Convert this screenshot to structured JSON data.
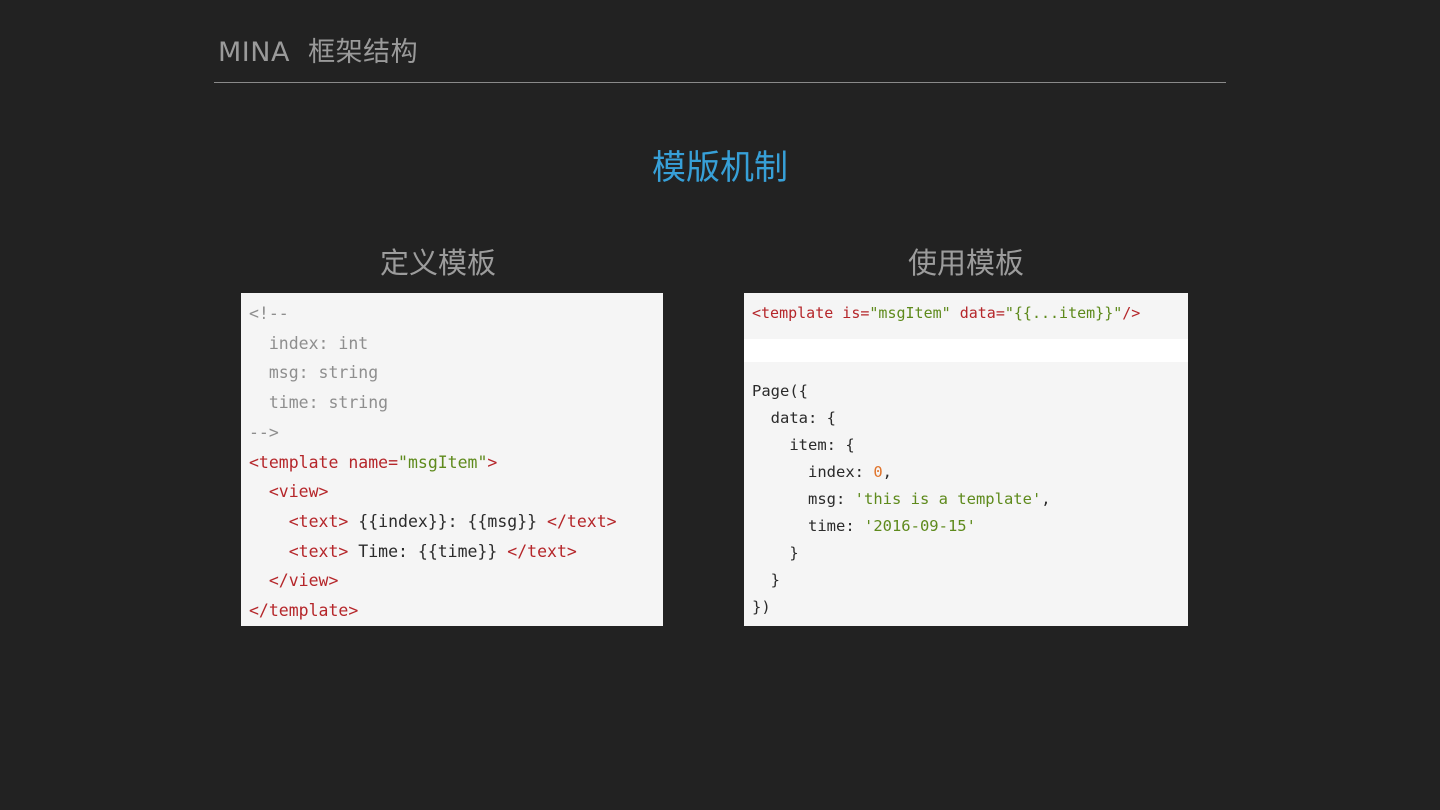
{
  "header": {
    "title": "MINA  框架结构"
  },
  "main_title": "模版机制",
  "left": {
    "heading": "定义模板",
    "code_lines": [
      [
        {
          "t": "<!--",
          "c": "c-comment"
        }
      ],
      [
        {
          "t": "  index: int",
          "c": "c-comment"
        }
      ],
      [
        {
          "t": "  msg: string",
          "c": "c-comment"
        }
      ],
      [
        {
          "t": "  time: string",
          "c": "c-comment"
        }
      ],
      [
        {
          "t": "-->",
          "c": "c-comment"
        }
      ],
      [
        {
          "t": "<template name=",
          "c": "c-tag"
        },
        {
          "t": "\"msgItem\"",
          "c": "c-attr-val"
        },
        {
          "t": ">",
          "c": "c-tag"
        }
      ],
      [
        {
          "t": "  <view>",
          "c": "c-tag"
        }
      ],
      [
        {
          "t": "    <text>",
          "c": "c-tag"
        },
        {
          "t": " {{index}}: {{msg}} ",
          "c": "c-plain"
        },
        {
          "t": "</text>",
          "c": "c-tag"
        }
      ],
      [
        {
          "t": "    <text>",
          "c": "c-tag"
        },
        {
          "t": " Time: {{time}} ",
          "c": "c-plain"
        },
        {
          "t": "</text>",
          "c": "c-tag"
        }
      ],
      [
        {
          "t": "  </view>",
          "c": "c-tag"
        }
      ],
      [
        {
          "t": "</template>",
          "c": "c-tag"
        }
      ]
    ]
  },
  "right": {
    "heading": "使用模板",
    "template_lines": [
      [
        {
          "t": "<template is=",
          "c": "c-tag"
        },
        {
          "t": "\"msgItem\"",
          "c": "c-attr-val"
        },
        {
          "t": " data=",
          "c": "c-tag"
        },
        {
          "t": "\"{{...item}}\"",
          "c": "c-attr-val"
        },
        {
          "t": "/>",
          "c": "c-tag"
        }
      ]
    ],
    "page_lines": [
      [
        {
          "t": "Page({",
          "c": "c-plain"
        }
      ],
      [
        {
          "t": "  data: {",
          "c": "c-plain"
        }
      ],
      [
        {
          "t": "    item: {",
          "c": "c-plain"
        }
      ],
      [
        {
          "t": "      index: ",
          "c": "c-plain"
        },
        {
          "t": "0",
          "c": "c-num"
        },
        {
          "t": ",",
          "c": "c-plain"
        }
      ],
      [
        {
          "t": "      msg: ",
          "c": "c-plain"
        },
        {
          "t": "'this is a template'",
          "c": "c-str"
        },
        {
          "t": ",",
          "c": "c-plain"
        }
      ],
      [
        {
          "t": "      time: ",
          "c": "c-plain"
        },
        {
          "t": "'2016-09-15'",
          "c": "c-str"
        }
      ],
      [
        {
          "t": "    }",
          "c": "c-plain"
        }
      ],
      [
        {
          "t": "  }",
          "c": "c-plain"
        }
      ],
      [
        {
          "t": "})",
          "c": "c-plain"
        }
      ]
    ]
  },
  "colors": {
    "background": "#222222",
    "title_accent": "#37a0d8",
    "tag": "#b5262a",
    "string": "#5e8a1c",
    "number": "#e0742c",
    "comment": "#8e8e8e"
  }
}
